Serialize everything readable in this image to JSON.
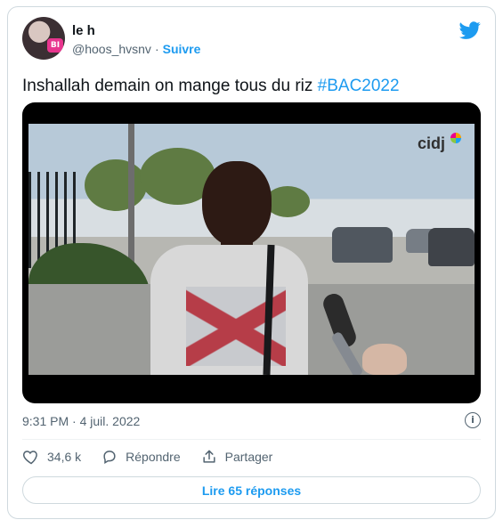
{
  "tweet": {
    "name": "le h",
    "handle": "@hoos_hvsnv",
    "separator": "·",
    "follow_label": "Suivre",
    "text_prefix": "Inshallah demain on mange tous du riz",
    "hashtag": "#BAC2022",
    "timestamp": "9:31 PM · 4 juil. 2022"
  },
  "video": {
    "watermark": "cidj"
  },
  "actions": {
    "likes": "34,6 k",
    "reply_label": "Répondre",
    "share_label": "Partager"
  },
  "footer": {
    "read_replies_label": "Lire 65 réponses"
  },
  "icons": {
    "avatar_badge": "BI",
    "info": "i"
  },
  "colors": {
    "accent": "#1d9bf0",
    "secondary_text": "#536471"
  }
}
